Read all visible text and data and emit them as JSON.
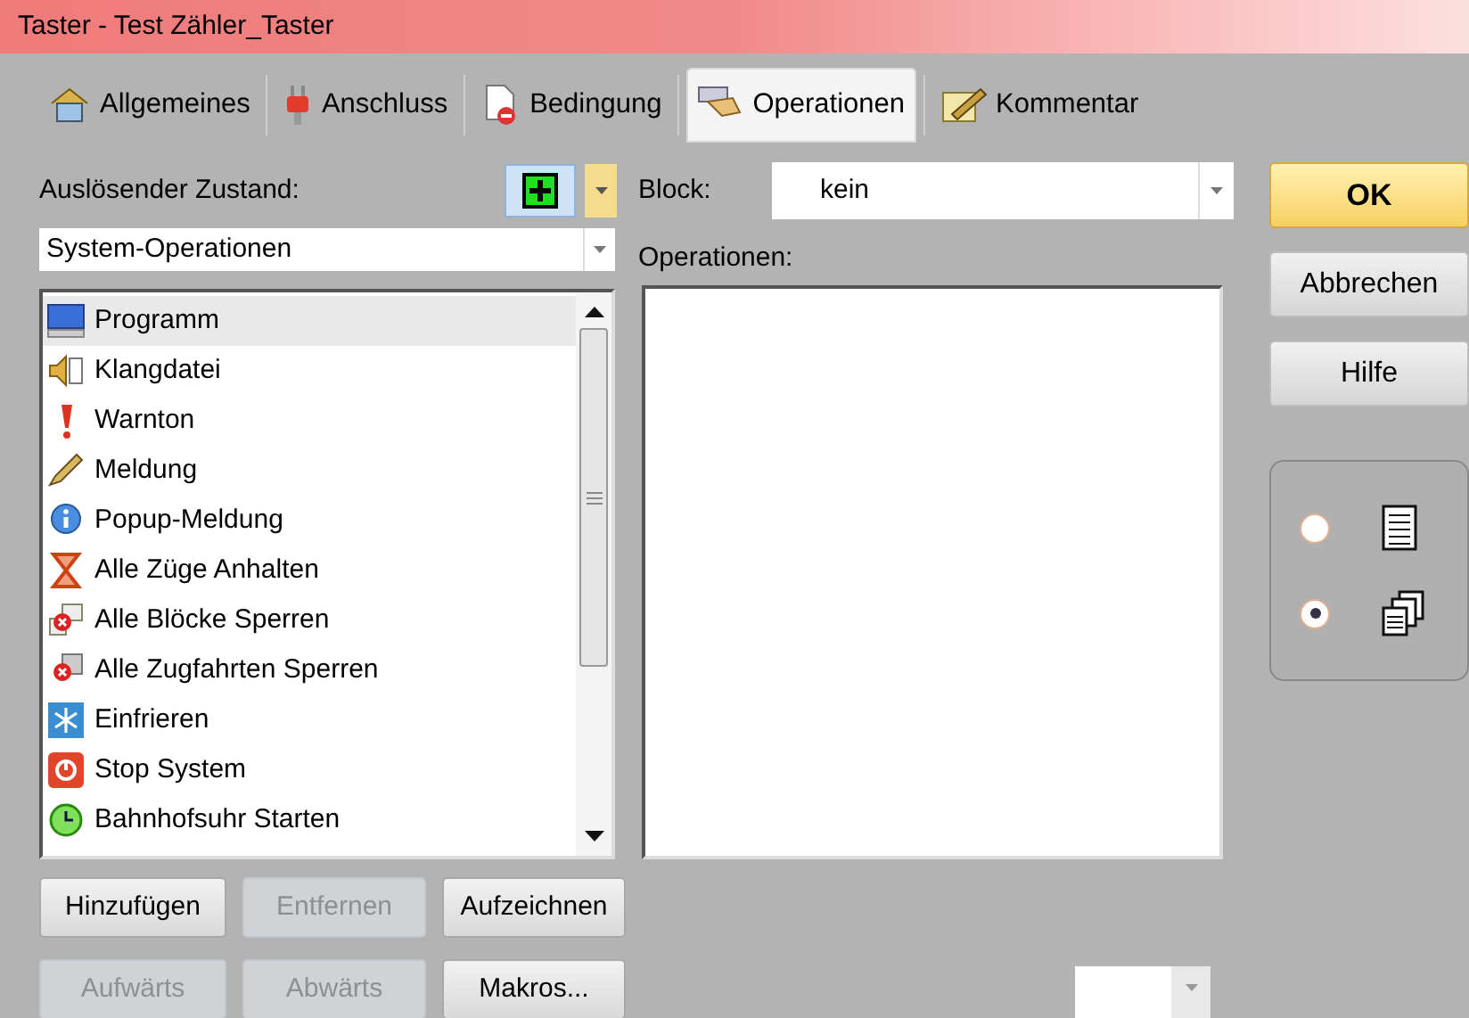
{
  "window": {
    "title": "Taster - Test Zähler_Taster"
  },
  "tabs": [
    {
      "label": "Allgemeines",
      "selected": false
    },
    {
      "label": "Anschluss",
      "selected": false
    },
    {
      "label": "Bedingung",
      "selected": false
    },
    {
      "label": "Operationen",
      "selected": true
    },
    {
      "label": "Kommentar",
      "selected": false
    }
  ],
  "trigger": {
    "label": "Auslösender Zustand:"
  },
  "category": {
    "value": "System-Operationen"
  },
  "operation_list": [
    {
      "label": "Programm",
      "selected": true
    },
    {
      "label": "Klangdatei",
      "selected": false
    },
    {
      "label": "Warnton",
      "selected": false
    },
    {
      "label": "Meldung",
      "selected": false
    },
    {
      "label": "Popup-Meldung",
      "selected": false
    },
    {
      "label": "Alle Züge Anhalten",
      "selected": false
    },
    {
      "label": "Alle Blöcke Sperren",
      "selected": false
    },
    {
      "label": "Alle Zugfahrten Sperren",
      "selected": false
    },
    {
      "label": "Einfrieren",
      "selected": false
    },
    {
      "label": "Stop System",
      "selected": false
    },
    {
      "label": "Bahnhofsuhr Starten",
      "selected": false
    }
  ],
  "list_buttons": [
    {
      "label": "Hinzufügen",
      "disabled": false
    },
    {
      "label": "Entfernen",
      "disabled": true
    },
    {
      "label": "Aufzeichnen",
      "disabled": false
    },
    {
      "label": "Aufwärts",
      "disabled": true
    },
    {
      "label": "Abwärts",
      "disabled": true
    },
    {
      "label": "Makros...",
      "disabled": false
    }
  ],
  "block": {
    "label": "Block:",
    "value": "kein"
  },
  "operations": {
    "label": "Operationen:"
  },
  "dialog_buttons": [
    {
      "label": "OK",
      "default": true
    },
    {
      "label": "Abbrechen",
      "default": false
    },
    {
      "label": "Hilfe",
      "default": false
    }
  ],
  "view_options": [
    {
      "selected": false
    },
    {
      "selected": true
    }
  ]
}
